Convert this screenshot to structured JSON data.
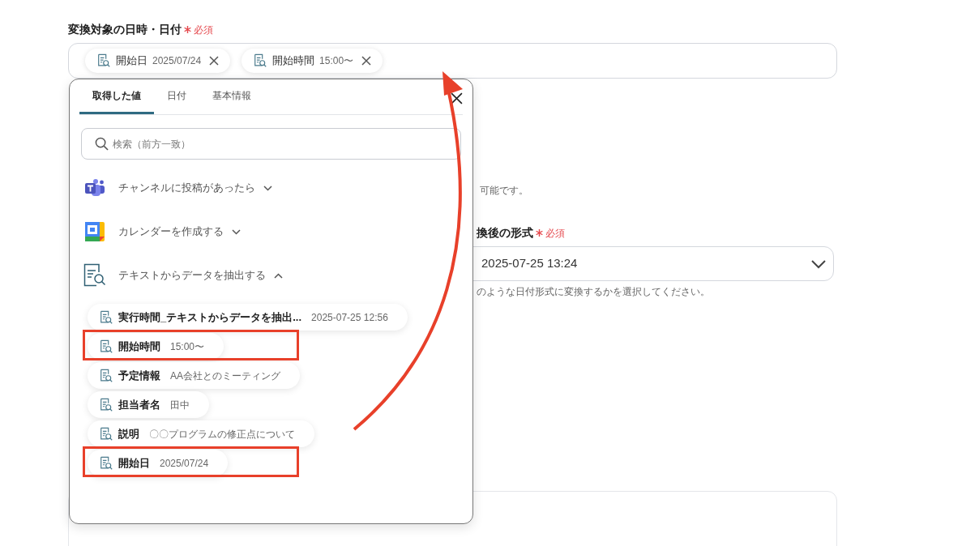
{
  "target_field": {
    "label": "変換対象の日時・日付",
    "required": "必須",
    "tokens": [
      {
        "name": "開始日",
        "value": "2025/07/24"
      },
      {
        "name": "開始時間",
        "value": "15:00〜"
      }
    ]
  },
  "background": {
    "note_fragment": "可能です。",
    "format_label": "換後の形式",
    "format_required": "必須",
    "format_value": "2025-07-25 13:24",
    "format_help": "のような日付形式に変換するかを選択してください。"
  },
  "popup": {
    "tabs": [
      {
        "label": "取得した値",
        "selected": true
      },
      {
        "label": "日付",
        "selected": false
      },
      {
        "label": "基本情報",
        "selected": false
      }
    ],
    "search": {
      "placeholder": "検索（前方一致）"
    },
    "groups": [
      {
        "kind": "chat",
        "title": "チャンネルに投稿があったら",
        "expanded": false
      },
      {
        "kind": "calendar",
        "title": "カレンダーを作成する",
        "expanded": false
      },
      {
        "kind": "document",
        "title": "テキストからデータを抽出する",
        "expanded": true
      }
    ],
    "values": [
      {
        "name": "実行時間_テキストからデータを抽出...",
        "value": "2025-07-25 12:56",
        "highlighted": false
      },
      {
        "name": "開始時間",
        "value": "15:00〜",
        "highlighted": true
      },
      {
        "name": "予定情報",
        "value": "AA会社とのミーティング",
        "highlighted": false
      },
      {
        "name": "担当者名",
        "value": "田中",
        "highlighted": false
      },
      {
        "name": "説明",
        "value": "〇〇プログラムの修正点について",
        "highlighted": false
      },
      {
        "name": "開始日",
        "value": "2025/07/24",
        "highlighted": true
      }
    ]
  }
}
